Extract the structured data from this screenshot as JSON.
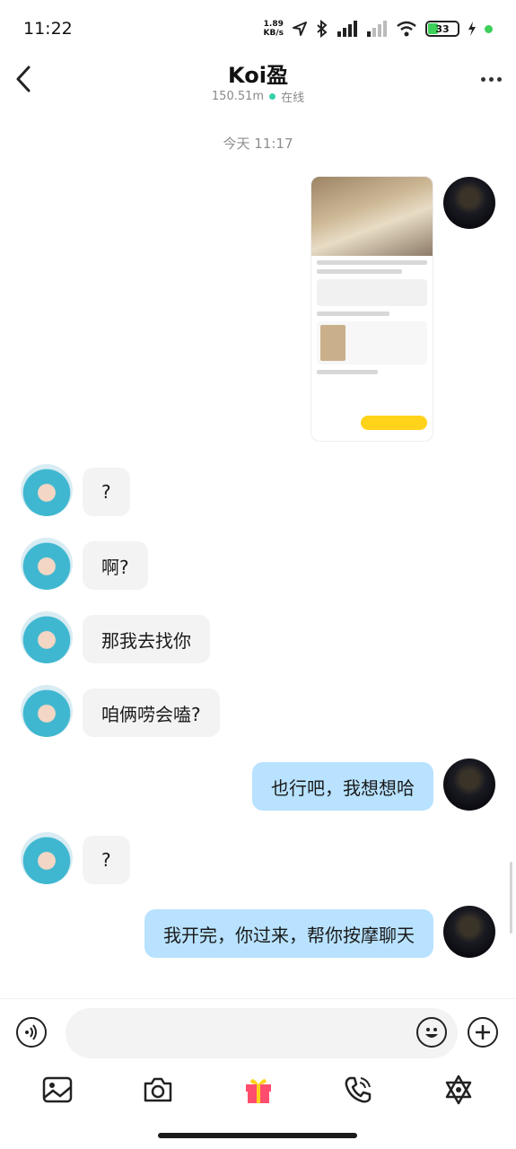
{
  "status_bar": {
    "time": "11:22",
    "speed_value": "1.89",
    "speed_unit": "KB/s",
    "battery": "33"
  },
  "header": {
    "title": "Koi盈",
    "distance": "150.51m",
    "status": "在线"
  },
  "chat": {
    "timestamp": "今天 11:17",
    "messages": [
      {
        "from": "me",
        "type": "image"
      },
      {
        "from": "friend",
        "text": "?"
      },
      {
        "from": "friend",
        "text": "啊?"
      },
      {
        "from": "friend",
        "text": "那我去找你"
      },
      {
        "from": "friend",
        "text": "咱俩唠会嗑?"
      },
      {
        "from": "me",
        "text": "也行吧，我想想哈"
      },
      {
        "from": "friend",
        "text": "?"
      },
      {
        "from": "me",
        "text": "我开完，你过来，帮你按摩聊天"
      }
    ]
  },
  "input": {
    "placeholder": ""
  },
  "icons": {
    "back": "chevron-left-icon",
    "more": "more-icon",
    "voice": "voice-icon",
    "emoji": "emoji-icon",
    "plus": "plus-icon",
    "image": "image-icon",
    "camera": "camera-icon",
    "gift": "gift-icon",
    "call": "phone-call-icon",
    "star": "star-icon"
  },
  "colors": {
    "my_bubble": "#b8e2ff",
    "friend_bubble": "#f3f3f3",
    "online": "#35d0a5",
    "gift": "#ff4d6d"
  }
}
